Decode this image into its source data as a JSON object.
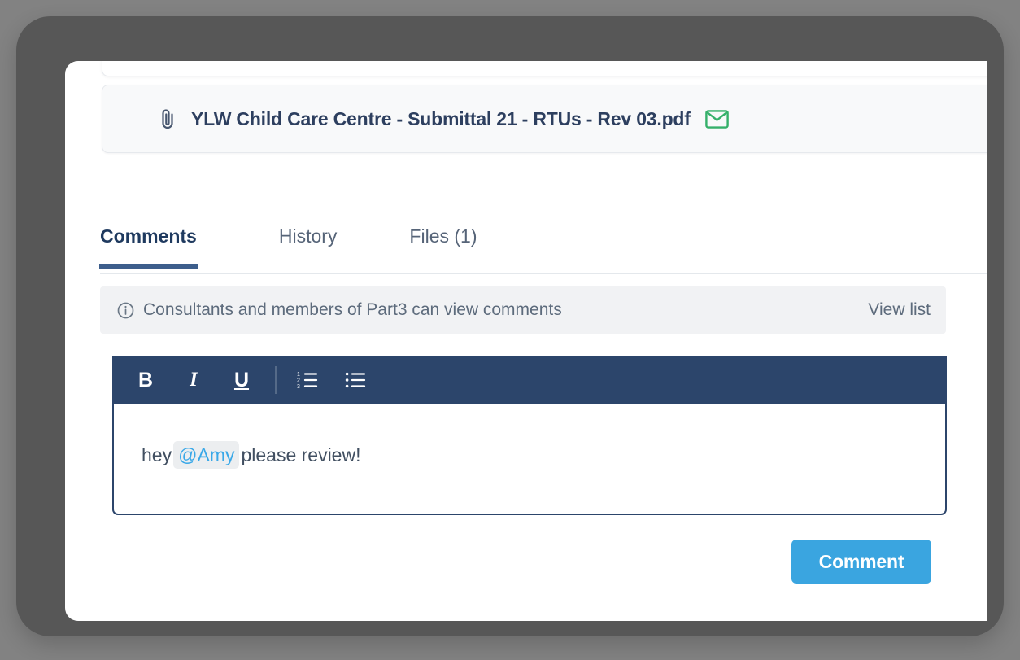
{
  "attachment": {
    "clip_icon": "paperclip-icon",
    "filename": "YLW Child Care Centre - Submittal 21 - RTUs - Rev 03.pdf",
    "mail_icon": "envelope-icon",
    "mail_icon_color": "#35b06a"
  },
  "tabs": [
    {
      "label": "Comments",
      "active": true
    },
    {
      "label": "History",
      "active": false
    },
    {
      "label": "Files (1)",
      "active": false
    }
  ],
  "info_banner": {
    "icon": "info-circle-icon",
    "text": "Consultants and members of Part3 can view comments",
    "action_label": "View list"
  },
  "editor": {
    "toolbar": {
      "bold_label": "B",
      "italic_label": "I",
      "underline_label": "U",
      "ordered_list_icon": "ordered-list-icon",
      "unordered_list_icon": "bullet-list-icon"
    },
    "content": {
      "before_mention": "hey",
      "mention": "@Amy",
      "after_mention": "please review!"
    }
  },
  "submit": {
    "label": "Comment",
    "color": "#3aa5e0"
  },
  "theme": {
    "navy": "#2c456b",
    "accent_blue": "#3aa5e0",
    "green": "#35b06a",
    "bezel": "#575757",
    "page_bg": "#828282"
  }
}
